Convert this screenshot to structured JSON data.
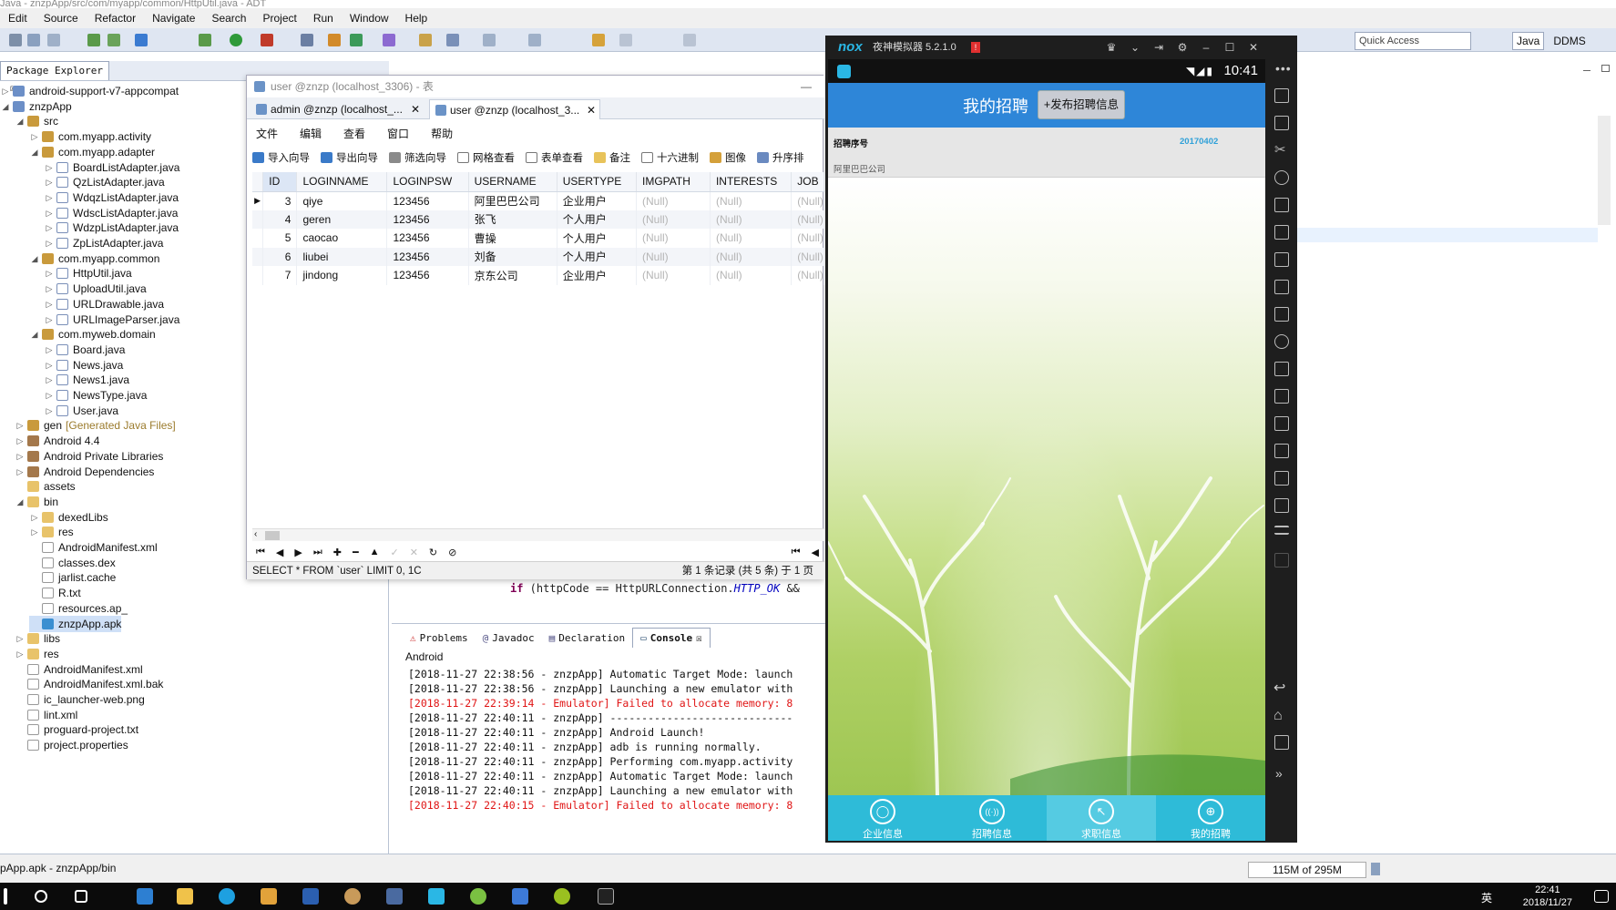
{
  "window_title": "Java - znzpApp/src/com/myapp/common/HttpUtil.java - ADT",
  "menu": [
    "Edit",
    "Source",
    "Refactor",
    "Navigate",
    "Search",
    "Project",
    "Run",
    "Window",
    "Help"
  ],
  "quick_access": "Quick Access",
  "perspectives": [
    "Java",
    "DDMS"
  ],
  "package_explorer": {
    "tab": "Package Explorer",
    "tree": [
      {
        "label": "android-support-v7-appcompat",
        "depth": 0,
        "icon": "proj",
        "arrow": "▷"
      },
      {
        "label": "znzpApp",
        "depth": 0,
        "icon": "proj",
        "arrow": "◢"
      },
      {
        "label": "src",
        "depth": 1,
        "icon": "pkg",
        "arrow": "◢"
      },
      {
        "label": "com.myapp.activity",
        "depth": 2,
        "icon": "pkg",
        "arrow": "▷"
      },
      {
        "label": "com.myapp.adapter",
        "depth": 2,
        "icon": "pkg",
        "arrow": "◢"
      },
      {
        "label": "BoardListAdapter.java",
        "depth": 3,
        "icon": "java",
        "arrow": "▷"
      },
      {
        "label": "QzListAdapter.java",
        "depth": 3,
        "icon": "java",
        "arrow": "▷"
      },
      {
        "label": "WdqzListAdapter.java",
        "depth": 3,
        "icon": "java",
        "arrow": "▷"
      },
      {
        "label": "WdscListAdapter.java",
        "depth": 3,
        "icon": "java",
        "arrow": "▷"
      },
      {
        "label": "WdzpListAdapter.java",
        "depth": 3,
        "icon": "java",
        "arrow": "▷"
      },
      {
        "label": "ZpListAdapter.java",
        "depth": 3,
        "icon": "java",
        "arrow": "▷"
      },
      {
        "label": "com.myapp.common",
        "depth": 2,
        "icon": "pkg",
        "arrow": "◢"
      },
      {
        "label": "HttpUtil.java",
        "depth": 3,
        "icon": "java",
        "arrow": "▷"
      },
      {
        "label": "UploadUtil.java",
        "depth": 3,
        "icon": "java",
        "arrow": "▷"
      },
      {
        "label": "URLDrawable.java",
        "depth": 3,
        "icon": "java",
        "arrow": "▷"
      },
      {
        "label": "URLImageParser.java",
        "depth": 3,
        "icon": "java",
        "arrow": "▷"
      },
      {
        "label": "com.myweb.domain",
        "depth": 2,
        "icon": "pkg",
        "arrow": "◢"
      },
      {
        "label": "Board.java",
        "depth": 3,
        "icon": "java",
        "arrow": "▷"
      },
      {
        "label": "News.java",
        "depth": 3,
        "icon": "java",
        "arrow": "▷"
      },
      {
        "label": "News1.java",
        "depth": 3,
        "icon": "java",
        "arrow": "▷"
      },
      {
        "label": "NewsType.java",
        "depth": 3,
        "icon": "java",
        "arrow": "▷"
      },
      {
        "label": "User.java",
        "depth": 3,
        "icon": "java",
        "arrow": "▷"
      },
      {
        "label": "gen",
        "suffix": "[Generated Java Files]",
        "depth": 1,
        "icon": "pkg",
        "arrow": "▷"
      },
      {
        "label": "Android 4.4",
        "depth": 1,
        "icon": "lib",
        "arrow": "▷"
      },
      {
        "label": "Android Private Libraries",
        "depth": 1,
        "icon": "lib",
        "arrow": "▷"
      },
      {
        "label": "Android Dependencies",
        "depth": 1,
        "icon": "lib",
        "arrow": "▷"
      },
      {
        "label": "assets",
        "depth": 1,
        "icon": "folder",
        "arrow": ""
      },
      {
        "label": "bin",
        "depth": 1,
        "icon": "folder",
        "arrow": "◢"
      },
      {
        "label": "dexedLibs",
        "depth": 2,
        "icon": "folder",
        "arrow": "▷"
      },
      {
        "label": "res",
        "depth": 2,
        "icon": "folder",
        "arrow": "▷"
      },
      {
        "label": "AndroidManifest.xml",
        "depth": 2,
        "icon": "file",
        "arrow": ""
      },
      {
        "label": "classes.dex",
        "depth": 2,
        "icon": "file",
        "arrow": ""
      },
      {
        "label": "jarlist.cache",
        "depth": 2,
        "icon": "file",
        "arrow": ""
      },
      {
        "label": "R.txt",
        "depth": 2,
        "icon": "file",
        "arrow": ""
      },
      {
        "label": "resources.ap_",
        "depth": 2,
        "icon": "file",
        "arrow": ""
      },
      {
        "label": "znzpApp.apk",
        "depth": 2,
        "icon": "apk",
        "arrow": "",
        "selected": true
      },
      {
        "label": "libs",
        "depth": 1,
        "icon": "folder",
        "arrow": "▷"
      },
      {
        "label": "res",
        "depth": 1,
        "icon": "folder",
        "arrow": "▷"
      },
      {
        "label": "AndroidManifest.xml",
        "depth": 1,
        "icon": "file",
        "arrow": ""
      },
      {
        "label": "AndroidManifest.xml.bak",
        "depth": 1,
        "icon": "file",
        "arrow": ""
      },
      {
        "label": "ic_launcher-web.png",
        "depth": 1,
        "icon": "file",
        "arrow": ""
      },
      {
        "label": "lint.xml",
        "depth": 1,
        "icon": "file",
        "arrow": ""
      },
      {
        "label": "proguard-project.txt",
        "depth": 1,
        "icon": "file",
        "arrow": ""
      },
      {
        "label": "project.properties",
        "depth": 1,
        "icon": "file",
        "arrow": ""
      }
    ]
  },
  "navicat": {
    "title": "user @znzp (localhost_3306) - 表",
    "tabs": [
      {
        "label": "admin @znzp (localhost_...",
        "active": false
      },
      {
        "label": "user @znzp (localhost_3...",
        "active": true
      }
    ],
    "menu": [
      "文件",
      "编辑",
      "查看",
      "窗口",
      "帮助"
    ],
    "tools": [
      "导入向导",
      "导出向导",
      "筛选向导",
      "网格查看",
      "表单查看",
      "备注",
      "十六进制",
      "图像",
      "升序排"
    ],
    "columns": [
      "ID",
      "LOGINNAME",
      "LOGINPSW",
      "USERNAME",
      "USERTYPE",
      "IMGPATH",
      "INTERESTS",
      "JOB"
    ],
    "rows": [
      [
        "3",
        "qiye",
        "123456",
        "阿里巴巴公司",
        "企业用户",
        "(Null)",
        "(Null)",
        "(Null)"
      ],
      [
        "4",
        "geren",
        "123456",
        "张飞",
        "个人用户",
        "(Null)",
        "(Null)",
        "(Null)"
      ],
      [
        "5",
        "caocao",
        "123456",
        "曹操",
        "个人用户",
        "(Null)",
        "(Null)",
        "(Null)"
      ],
      [
        "6",
        "liubei",
        "123456",
        "刘备",
        "个人用户",
        "(Null)",
        "(Null)",
        "(Null)"
      ],
      [
        "7",
        "jindong",
        "123456",
        "京东公司",
        "企业用户",
        "(Null)",
        "(Null)",
        "(Null)"
      ]
    ],
    "sql": "SELECT * FROM `user` LIMIT 0, 1C",
    "record_status": "第 1 条记录 (共 5 条) 于 1 页"
  },
  "editor_line": {
    "kw": "if",
    "text1": " (httpCode == HttpURLConnection.",
    "const": "HTTP_OK",
    "text2": " &&"
  },
  "console": {
    "tabs": [
      "Problems",
      "Javadoc",
      "Declaration",
      "Console"
    ],
    "label": "Android",
    "lines": [
      {
        "text": "[2018-11-27 22:38:56 - znzpApp] Automatic Target Mode: launch",
        "err": false
      },
      {
        "text": "[2018-11-27 22:38:56 - znzpApp] Launching a new emulator with",
        "err": false
      },
      {
        "text": "[2018-11-27 22:39:14 - Emulator] Failed to allocate memory: 8",
        "err": true
      },
      {
        "text": "[2018-11-27 22:40:11 - znzpApp] -----------------------------",
        "err": false
      },
      {
        "text": "[2018-11-27 22:40:11 - znzpApp] Android Launch!",
        "err": false
      },
      {
        "text": "[2018-11-27 22:40:11 - znzpApp] adb is running normally.",
        "err": false
      },
      {
        "text": "[2018-11-27 22:40:11 - znzpApp] Performing com.myapp.activity",
        "err": false
      },
      {
        "text": "[2018-11-27 22:40:11 - znzpApp] Automatic Target Mode: launch",
        "err": false
      },
      {
        "text": "[2018-11-27 22:40:11 - znzpApp] Launching a new emulator with",
        "err": false
      },
      {
        "text": "[2018-11-27 22:40:15 - Emulator] Failed to allocate memory: 8",
        "err": true
      }
    ]
  },
  "emulator": {
    "brand": "nox",
    "name": "夜神模拟器 5.2.1.0",
    "badge": "!",
    "time": "10:41",
    "app": {
      "header_title": "我的招聘",
      "publish_button": "+发布招聘信息",
      "row_title": "招聘序号",
      "row_date": "20170402",
      "row_company": "阿里巴巴公司",
      "nav": [
        {
          "label": "企业信息",
          "icon": "person-icon",
          "glyph": "◯"
        },
        {
          "label": "招聘信息",
          "icon": "broadcast-icon",
          "glyph": "((·))"
        },
        {
          "label": "求职信息",
          "icon": "cursor-icon",
          "glyph": "↖"
        },
        {
          "label": "我的招聘",
          "icon": "globe-icon",
          "glyph": "⊕"
        }
      ]
    }
  },
  "status_bar": {
    "path": "pApp.apk - znzpApp/bin",
    "memory": "115M of 295M"
  },
  "taskbar": {
    "time": "22:41",
    "date": "2018/11/27",
    "ime": "英"
  }
}
